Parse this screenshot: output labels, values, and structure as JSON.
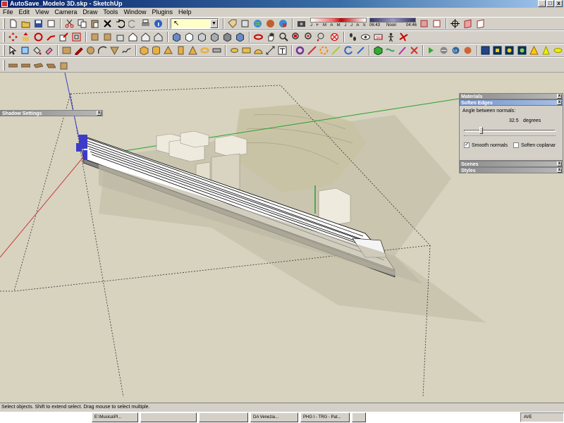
{
  "window": {
    "title": "AutoSave_Modelo 3D.skp - SketchUp",
    "minimize": "_",
    "maximize": "□",
    "close": "x"
  },
  "menu": {
    "items": [
      "File",
      "Edit",
      "View",
      "Camera",
      "Draw",
      "Tools",
      "Window",
      "Plugins",
      "Help"
    ]
  },
  "toolbar": {
    "layer_select_value": "",
    "shadow_months": "J F M A M J J A S O N D",
    "time_start": "06:43",
    "time_noon": "Noon",
    "time_end": "04:46"
  },
  "panels": {
    "shadow_settings": "Shadow Settings",
    "materials": "Materials",
    "soften_edges": "Soften Edges",
    "angle_label": "Angle between normals:",
    "angle_value": "32.5",
    "angle_unit": "degrees",
    "smooth_normals": "Smooth normals",
    "soften_coplanar": "Soften coplanar",
    "smooth_checked": "✓",
    "scenes": "Scenes",
    "styles": "Styles"
  },
  "status": {
    "message": "Select objects. Shift to extend select. Drag mouse to select multiple."
  },
  "taskbar": {
    "items": [
      "E:\\Musica\\Pl...",
      "",
      "",
      "DA Venezia...",
      "PHG I - TRG - Pat...",
      ""
    ],
    "clock": "AVE"
  },
  "colors": {
    "viewport_bg": "#d7d3bf",
    "axis_red": "#c83c3c",
    "axis_green": "#2aa02a",
    "axis_blue": "#3c3cc8"
  }
}
